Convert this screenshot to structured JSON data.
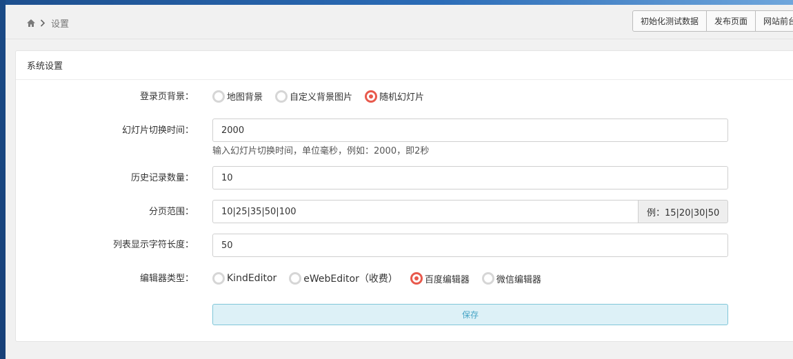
{
  "breadcrumb": {
    "current": "设置"
  },
  "toolbar": {
    "buttons": [
      "初始化测试数据",
      "发布页面",
      "网站前台"
    ]
  },
  "panel": {
    "title": "系统设置"
  },
  "form": {
    "login_bg": {
      "label": "登录页背景：",
      "options": [
        "地图背景",
        "自定义背景图片",
        "随机幻灯片"
      ],
      "selected": "随机幻灯片"
    },
    "slide_interval": {
      "label": "幻灯片切换时间：",
      "value": "2000",
      "help": "输入幻灯片切换时间，单位毫秒，例如：2000，即2秒"
    },
    "history_count": {
      "label": "历史记录数量：",
      "value": "10"
    },
    "page_range": {
      "label": "分页范围：",
      "value": "10|25|35|50|100",
      "example": "例：15|20|30|50"
    },
    "list_length": {
      "label": "列表显示字符长度：",
      "value": "50"
    },
    "editor_type": {
      "label": "编辑器类型：",
      "options": [
        "KindEditor",
        "eWebEditor（收费）",
        "百度编辑器",
        "微信编辑器"
      ],
      "selected": "百度编辑器"
    },
    "save_label": "保存"
  },
  "colors": {
    "accent_radio": "#e8594c",
    "save_bg": "#ddf1f7",
    "save_text": "#47a5c6"
  }
}
